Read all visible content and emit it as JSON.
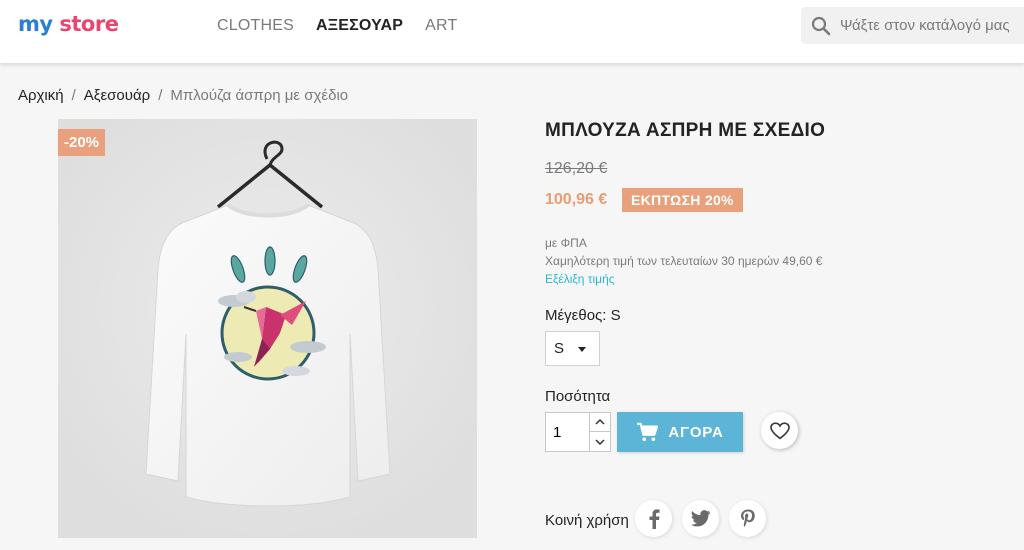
{
  "header": {
    "logo_my": "my",
    "logo_store": "store",
    "nav": [
      "CLOTHES",
      "ΑΞΕΣΟΥΑΡ",
      "ART"
    ],
    "search_placeholder": "Ψάξτε στον κατάλογό μας"
  },
  "breadcrumb": {
    "home": "Αρχική",
    "category": "Αξεσουάρ",
    "current": "Μπλούζα άσπρη με σχέδιο",
    "separator": "/"
  },
  "product": {
    "flag": "-20%",
    "title": "ΜΠΛΟΥΖΑ ΑΣΠΡΗ ΜΕ ΣΧΕΔΙΟ",
    "old_price": "126,20 €",
    "price": "100,96 €",
    "discount": "ΕΚΠΤΩΣΗ 20%",
    "vat": "με ΦΠΑ",
    "lowest_price": "Χαμηλότερη τιμή των τελευταίων 30 ημερών 49,60 €",
    "price_history": "Εξέλιξη τιμής",
    "size_label": "Μέγεθος: S",
    "size_value": "S",
    "qty_label": "Ποσότητα",
    "qty_value": "1",
    "buy_label": "ΑΓΟΡΑ",
    "share_label": "Κοινή χρήση"
  },
  "colors": {
    "accent": "#5cb5d6",
    "discount": "#e9a07c",
    "link": "#24b9d7"
  },
  "icons": {
    "search": "search-icon",
    "cart": "cart-icon",
    "wishlist": "heart-icon",
    "facebook": "facebook-icon",
    "twitter": "twitter-icon",
    "pinterest": "pinterest-icon"
  }
}
